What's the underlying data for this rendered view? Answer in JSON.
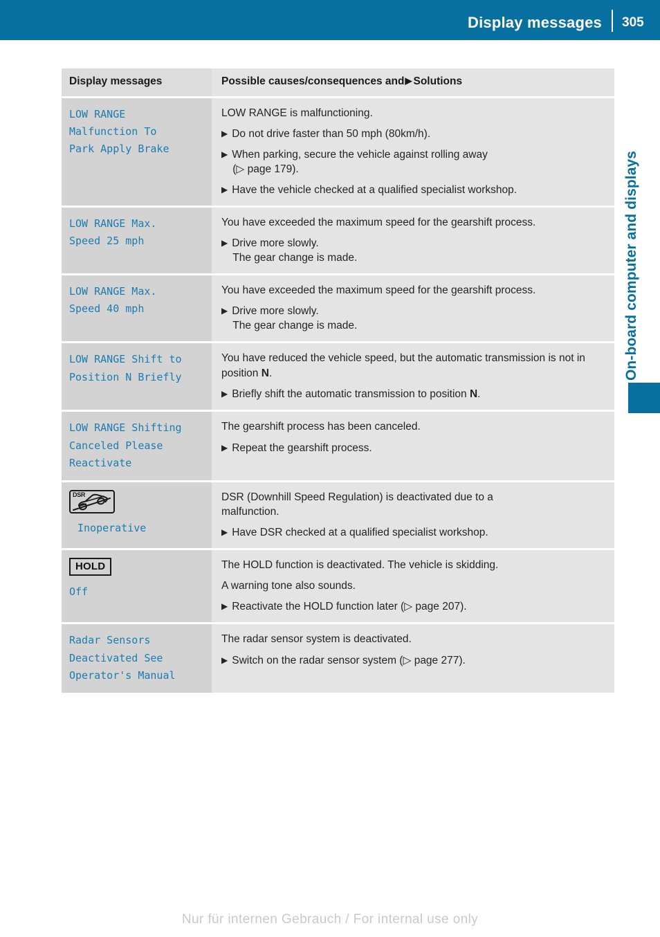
{
  "header": {
    "title": "Display messages",
    "page_number": "305"
  },
  "chapter_tab": {
    "label": "On-board computer and displays",
    "color": "#0770a0"
  },
  "table": {
    "columns": {
      "message_header": "Display messages",
      "solution_header_prefix": "Possible causes/consequences and",
      "solution_header_arrow": "▶",
      "solution_header_suffix": "Solutions"
    },
    "rows": [
      {
        "message": "LOW RANGE\nMalfunction To\nPark Apply Brake",
        "symbol": null,
        "intro": "LOW RANGE is malfunctioning.",
        "bullets": [
          {
            "text": "Do not drive faster than 50 mph (80km/h)."
          },
          {
            "text": "When parking, secure the vehicle against rolling away",
            "sub": "(▷ page 179)."
          },
          {
            "text": "Have the vehicle checked at a qualified specialist workshop."
          }
        ]
      },
      {
        "message": "LOW RANGE Max.\nSpeed 25 mph",
        "symbol": null,
        "intro": "You have exceeded the maximum speed for the gearshift process.",
        "bullets": [
          {
            "text": "Drive more slowly.",
            "sub": "The gear change is made."
          }
        ]
      },
      {
        "message": "LOW RANGE Max.\nSpeed 40 mph",
        "symbol": null,
        "intro": "You have exceeded the maximum speed for the gearshift process.",
        "bullets": [
          {
            "text": "Drive more slowly.",
            "sub": "The gear change is made."
          }
        ]
      },
      {
        "message": "LOW RANGE Shift to\nPosition N Briefly",
        "symbol": null,
        "intro_parts": [
          "You have reduced the vehicle speed, but the automatic transmission is not in position ",
          "N",
          "."
        ],
        "bullet_parts": [
          "Briefly shift the automatic transmission to position ",
          "N",
          "."
        ]
      },
      {
        "message": "LOW RANGE Shifting\nCanceled Please\nReactivate",
        "symbol": null,
        "intro": "The gearshift process has been canceled.",
        "bullets": [
          {
            "text": "Repeat the gearshift process."
          }
        ]
      },
      {
        "message": "Inoperative",
        "symbol": "dsr-symbol",
        "symbol_label": "DSR",
        "intro": "DSR (Downhill Speed Regulation) is deactivated due to a malfunction.",
        "bullets": [
          {
            "text": "Have DSR checked at a qualified specialist workshop."
          }
        ]
      },
      {
        "message": "Off",
        "symbol": "hold-symbol",
        "symbol_label": "HOLD",
        "intro": "The HOLD function is deactivated. The vehicle is skidding.",
        "intro2": "A warning tone also sounds.",
        "bullets": [
          {
            "text": "Reactivate the HOLD function later (▷ page 207)."
          }
        ]
      },
      {
        "message": "Radar Sensors\nDeactivated See\nOperator's Manual",
        "symbol": null,
        "intro": "The radar sensor system is deactivated.",
        "bullets": [
          {
            "text": "Switch on the radar sensor system (▷ page 277)."
          }
        ]
      }
    ]
  },
  "footer": {
    "watermark": "Nur für internen Gebrauch / For internal use only"
  }
}
